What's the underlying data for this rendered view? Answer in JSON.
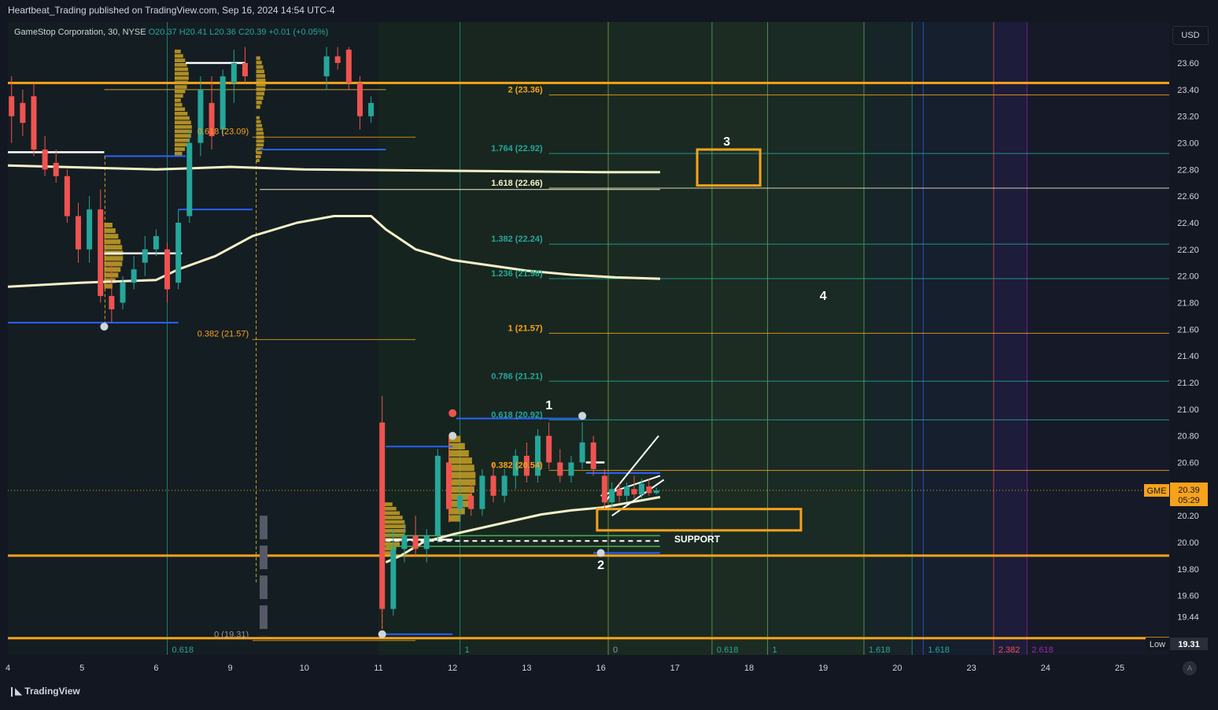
{
  "header": {
    "publisher_line": "Heartbeat_Trading published on TradingView.com, Sep 16, 2024 14:54 UTC-4",
    "symbol_line": "GameStop Corporation, 30, NYSE",
    "ohlc_line": "O20.37 H20.41 L20.36 C20.39 +0.01 (+0.05%)"
  },
  "currency_button": "USD",
  "footer": {
    "brand": "TradingView",
    "auto_label": "A"
  },
  "colors": {
    "background": "#131722",
    "bull": "#26a69a",
    "bear": "#ef5350",
    "orange": "#f7a21b",
    "cream": "#f5f0c8",
    "blue": "#2962ff",
    "volume_profile": "#c9a227"
  },
  "chart_data": {
    "type": "candlestick",
    "title": "GameStop Corporation, 30, NYSE",
    "ticker": "GME",
    "last_price": "20.39",
    "countdown": "05:29",
    "low_label": "Low",
    "low_value": "19.31",
    "ylim": [
      19.31,
      23.72
    ],
    "y_ticks": [
      "23.60",
      "23.40",
      "23.20",
      "23.00",
      "22.80",
      "22.60",
      "22.40",
      "22.20",
      "22.00",
      "21.80",
      "21.60",
      "21.40",
      "21.20",
      "21.00",
      "20.80",
      "20.60",
      "20.20",
      "20.00",
      "19.80",
      "19.60",
      "19.44"
    ],
    "x_ticks": [
      {
        "label": "4",
        "t": 0.0
      },
      {
        "label": "5",
        "t": 1.0
      },
      {
        "label": "6",
        "t": 2.0
      },
      {
        "label": "9",
        "t": 3.0
      },
      {
        "label": "10",
        "t": 4.0
      },
      {
        "label": "11",
        "t": 5.0
      },
      {
        "label": "12",
        "t": 6.0
      },
      {
        "label": "13",
        "t": 7.0
      },
      {
        "label": "16",
        "t": 8.0
      },
      {
        "label": "17",
        "t": 9.0
      },
      {
        "label": "18",
        "t": 10.0
      },
      {
        "label": "19",
        "t": 11.0
      },
      {
        "label": "20",
        "t": 12.0
      },
      {
        "label": "23",
        "t": 13.0
      },
      {
        "label": "24",
        "t": 14.0
      },
      {
        "label": "25",
        "t": 15.0
      }
    ],
    "fib_levels": [
      {
        "label": "2 (23.36)",
        "price": 23.36,
        "color": "#f7a21b"
      },
      {
        "label": "1.764 (22.92)",
        "price": 22.92,
        "color": "#26a69a"
      },
      {
        "label": "1.618 (22.66)",
        "price": 22.66,
        "color": "#f5f0c8"
      },
      {
        "label": "1.382 (22.24)",
        "price": 22.24,
        "color": "#26a69a"
      },
      {
        "label": "1.236 (21.98)",
        "price": 21.98,
        "color": "#22ab94"
      },
      {
        "label": "1 (21.57)",
        "price": 21.57,
        "color": "#f7a21b"
      },
      {
        "label": "0.786 (21.21)",
        "price": 21.21,
        "color": "#26a69a"
      },
      {
        "label": "0.618 (20.92)",
        "price": 20.92,
        "color": "#26a69a"
      },
      {
        "label": "0.382 (20.54)",
        "price": 20.54,
        "color": "#f7a21b"
      }
    ],
    "left_fib_labels": [
      {
        "label": "0.618 (23.09)",
        "price": 23.09
      },
      {
        "label": "0.382 (21.57)",
        "price": 21.57
      },
      {
        "label": "0 (19.31)",
        "price": 19.31
      }
    ],
    "time_fib_labels": [
      {
        "label": "0.618",
        "t": 2.15
      },
      {
        "label": "1",
        "t": 6.1
      },
      {
        "label": "0",
        "t": 8.1
      },
      {
        "label": "0.618",
        "t": 9.5
      },
      {
        "label": "1",
        "t": 10.25
      },
      {
        "label": "1.618",
        "t": 11.55
      },
      {
        "label": "1.618",
        "t": 12.35
      },
      {
        "label": "2.382",
        "t": 13.3
      },
      {
        "label": "2.618",
        "t": 13.75
      }
    ],
    "horizontal_levels": [
      23.45,
      19.9,
      19.28
    ],
    "annotations": [
      {
        "text": "1",
        "t": 7.3,
        "price": 21.0
      },
      {
        "text": "2",
        "t": 8.0,
        "price": 19.8
      },
      {
        "text": "3",
        "t": 9.7,
        "price": 22.98
      },
      {
        "text": "4",
        "t": 11.0,
        "price": 21.82
      },
      {
        "text": "SUPPORT",
        "t": 9.3,
        "price": 20.0
      }
    ],
    "candles": [
      {
        "t": 0.05,
        "o": 23.35,
        "h": 23.5,
        "l": 23.0,
        "c": 23.2
      },
      {
        "t": 0.2,
        "o": 23.3,
        "h": 23.4,
        "l": 23.05,
        "c": 23.15
      },
      {
        "t": 0.35,
        "o": 23.35,
        "h": 23.45,
        "l": 22.9,
        "c": 22.95
      },
      {
        "t": 0.5,
        "o": 22.95,
        "h": 23.05,
        "l": 22.75,
        "c": 22.8
      },
      {
        "t": 0.65,
        "o": 22.85,
        "h": 22.95,
        "l": 22.7,
        "c": 22.75
      },
      {
        "t": 0.8,
        "o": 22.75,
        "h": 22.8,
        "l": 22.4,
        "c": 22.45
      },
      {
        "t": 0.95,
        "o": 22.45,
        "h": 22.55,
        "l": 22.1,
        "c": 22.2
      },
      {
        "t": 1.1,
        "o": 22.2,
        "h": 22.6,
        "l": 22.1,
        "c": 22.5
      },
      {
        "t": 1.25,
        "o": 22.5,
        "h": 22.65,
        "l": 21.8,
        "c": 21.85
      },
      {
        "t": 1.4,
        "o": 21.85,
        "h": 22.1,
        "l": 21.65,
        "c": 21.75
      },
      {
        "t": 1.55,
        "o": 21.8,
        "h": 22.0,
        "l": 21.75,
        "c": 21.95
      },
      {
        "t": 1.7,
        "o": 21.95,
        "h": 22.15,
        "l": 21.9,
        "c": 22.05
      },
      {
        "t": 1.85,
        "o": 22.1,
        "h": 22.3,
        "l": 22.0,
        "c": 22.2
      },
      {
        "t": 2.0,
        "o": 22.2,
        "h": 22.35,
        "l": 22.15,
        "c": 22.3
      },
      {
        "t": 2.15,
        "o": 22.2,
        "h": 22.25,
        "l": 21.8,
        "c": 21.9
      },
      {
        "t": 2.3,
        "o": 21.95,
        "h": 22.5,
        "l": 21.9,
        "c": 22.4
      },
      {
        "t": 2.45,
        "o": 22.45,
        "h": 23.1,
        "l": 22.4,
        "c": 23.0
      },
      {
        "t": 2.6,
        "o": 23.0,
        "h": 23.5,
        "l": 22.9,
        "c": 23.4
      },
      {
        "t": 2.75,
        "o": 23.3,
        "h": 23.5,
        "l": 22.95,
        "c": 23.05
      },
      {
        "t": 2.9,
        "o": 23.1,
        "h": 23.55,
        "l": 23.05,
        "c": 23.5
      },
      {
        "t": 3.05,
        "o": 23.45,
        "h": 23.7,
        "l": 23.3,
        "c": 23.6
      },
      {
        "t": 3.2,
        "o": 23.6,
        "h": 23.72,
        "l": 23.45,
        "c": 23.5
      },
      {
        "t": 4.3,
        "o": 23.5,
        "h": 23.72,
        "l": 23.4,
        "c": 23.65
      },
      {
        "t": 4.45,
        "o": 23.65,
        "h": 23.72,
        "l": 23.55,
        "c": 23.6
      },
      {
        "t": 4.6,
        "o": 23.7,
        "h": 23.72,
        "l": 23.4,
        "c": 23.45
      },
      {
        "t": 4.75,
        "o": 23.45,
        "h": 23.5,
        "l": 23.1,
        "c": 23.2
      },
      {
        "t": 4.9,
        "o": 23.2,
        "h": 23.35,
        "l": 23.15,
        "c": 23.3
      },
      {
        "t": 5.05,
        "o": 20.9,
        "h": 21.1,
        "l": 19.35,
        "c": 19.5
      },
      {
        "t": 5.2,
        "o": 19.5,
        "h": 20.1,
        "l": 19.45,
        "c": 19.95
      },
      {
        "t": 5.35,
        "o": 19.95,
        "h": 20.15,
        "l": 19.85,
        "c": 20.05
      },
      {
        "t": 5.5,
        "o": 20.05,
        "h": 20.2,
        "l": 19.9,
        "c": 19.95
      },
      {
        "t": 5.65,
        "o": 19.95,
        "h": 20.1,
        "l": 19.85,
        "c": 20.05
      },
      {
        "t": 5.8,
        "o": 20.05,
        "h": 20.7,
        "l": 20.0,
        "c": 20.65
      },
      {
        "t": 5.95,
        "o": 20.6,
        "h": 20.8,
        "l": 20.15,
        "c": 20.25
      },
      {
        "t": 6.1,
        "o": 20.25,
        "h": 20.45,
        "l": 20.15,
        "c": 20.35
      },
      {
        "t": 6.25,
        "o": 20.35,
        "h": 20.45,
        "l": 20.2,
        "c": 20.25
      },
      {
        "t": 6.4,
        "o": 20.25,
        "h": 20.55,
        "l": 20.2,
        "c": 20.5
      },
      {
        "t": 6.55,
        "o": 20.5,
        "h": 20.6,
        "l": 20.3,
        "c": 20.35
      },
      {
        "t": 6.7,
        "o": 20.35,
        "h": 20.55,
        "l": 20.3,
        "c": 20.5
      },
      {
        "t": 6.85,
        "o": 20.5,
        "h": 20.7,
        "l": 20.4,
        "c": 20.65
      },
      {
        "t": 7.0,
        "o": 20.65,
        "h": 20.75,
        "l": 20.45,
        "c": 20.5
      },
      {
        "t": 7.15,
        "o": 20.5,
        "h": 20.85,
        "l": 20.45,
        "c": 20.8
      },
      {
        "t": 7.3,
        "o": 20.8,
        "h": 20.9,
        "l": 20.55,
        "c": 20.6
      },
      {
        "t": 7.45,
        "o": 20.6,
        "h": 20.7,
        "l": 20.45,
        "c": 20.5
      },
      {
        "t": 7.6,
        "o": 20.5,
        "h": 20.65,
        "l": 20.45,
        "c": 20.6
      },
      {
        "t": 7.75,
        "o": 20.6,
        "h": 20.9,
        "l": 20.55,
        "c": 20.75
      },
      {
        "t": 7.9,
        "o": 20.75,
        "h": 20.8,
        "l": 20.5,
        "c": 20.55
      },
      {
        "t": 8.05,
        "o": 20.5,
        "h": 20.55,
        "l": 20.25,
        "c": 20.3
      },
      {
        "t": 8.15,
        "o": 20.3,
        "h": 20.45,
        "l": 20.25,
        "c": 20.4
      },
      {
        "t": 8.25,
        "o": 20.4,
        "h": 20.45,
        "l": 20.3,
        "c": 20.35
      },
      {
        "t": 8.35,
        "o": 20.35,
        "h": 20.45,
        "l": 20.3,
        "c": 20.42
      },
      {
        "t": 8.45,
        "o": 20.4,
        "h": 20.5,
        "l": 20.33,
        "c": 20.36
      },
      {
        "t": 8.55,
        "o": 20.36,
        "h": 20.48,
        "l": 20.33,
        "c": 20.44
      },
      {
        "t": 8.65,
        "o": 20.42,
        "h": 20.48,
        "l": 20.35,
        "c": 20.37
      },
      {
        "t": 8.75,
        "o": 20.37,
        "h": 20.41,
        "l": 20.36,
        "c": 20.39
      }
    ]
  }
}
